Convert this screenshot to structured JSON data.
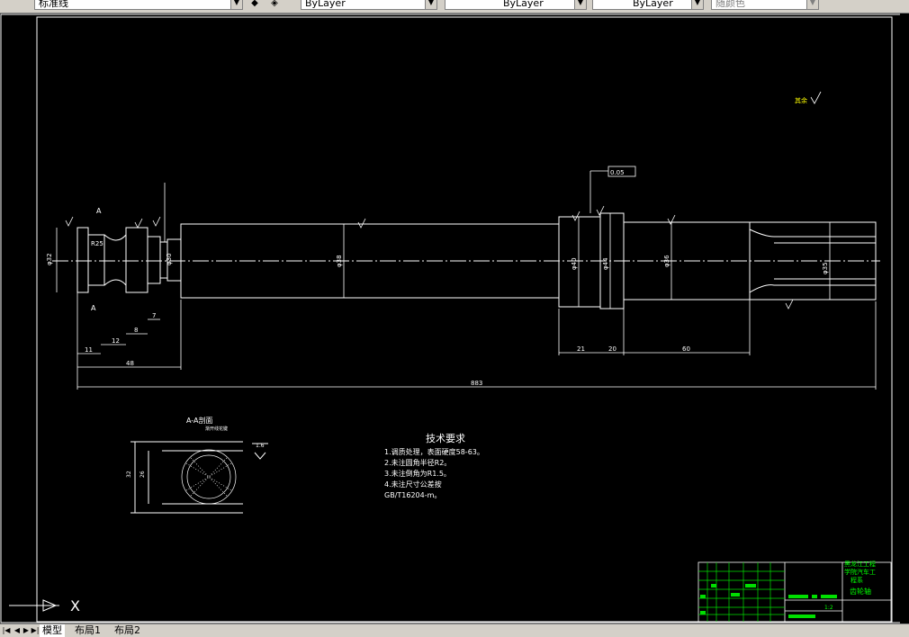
{
  "toolbar": {
    "text_style_value": "标准线",
    "layer_value": "ByLayer",
    "linetype_value": "ByLayer",
    "lineweight_value": "ByLayer",
    "plotstyle_value": "随颜色"
  },
  "drawing": {
    "roughness_top": "其余",
    "roughness_vals": [
      "1.6",
      "1.6",
      "1.6",
      "1.6",
      "1.6",
      "1.6",
      "1.6"
    ],
    "runout": "0.05",
    "section_label": "A-A剖面",
    "section_note": "渐开线花键",
    "section_letter": "A",
    "dims": {
      "phi30": "φ30",
      "phi38": "φ38",
      "phi40": "φ40",
      "phi44": "φ44",
      "phi36": "φ36",
      "phi35": "φ35",
      "phi32": "φ32",
      "r25": "R25",
      "d11": "11",
      "d12": "12",
      "d8": "8",
      "d7": "7",
      "d48": "48",
      "d21": "21",
      "d20": "20",
      "d60": "60",
      "d883": "883",
      "ft1": "1.6",
      "ft2": "2.5",
      "sec_d1": "32",
      "sec_d2": "26"
    },
    "tech_title": "技术要求",
    "tech_lines": [
      "1.调质处理，表面硬度58-63。",
      "2.未注圆角半径R2。",
      "3.未注倒角为R1.5。",
      "4.未注尺寸公差按",
      "GB/T16204-m。"
    ],
    "title_block": {
      "school_1": "黑龙江工程",
      "school_2": "学院汽车工",
      "school_3": "程系",
      "part_name": "齿轮轴",
      "scale": "1:2"
    },
    "ucs_label": "X"
  },
  "tabs": [
    "模型",
    "布局1",
    "布局2"
  ],
  "colors": {
    "line_white": "#ffffff",
    "accent_green": "#00ff00",
    "title_green": "#00e000",
    "background": "#000000"
  }
}
